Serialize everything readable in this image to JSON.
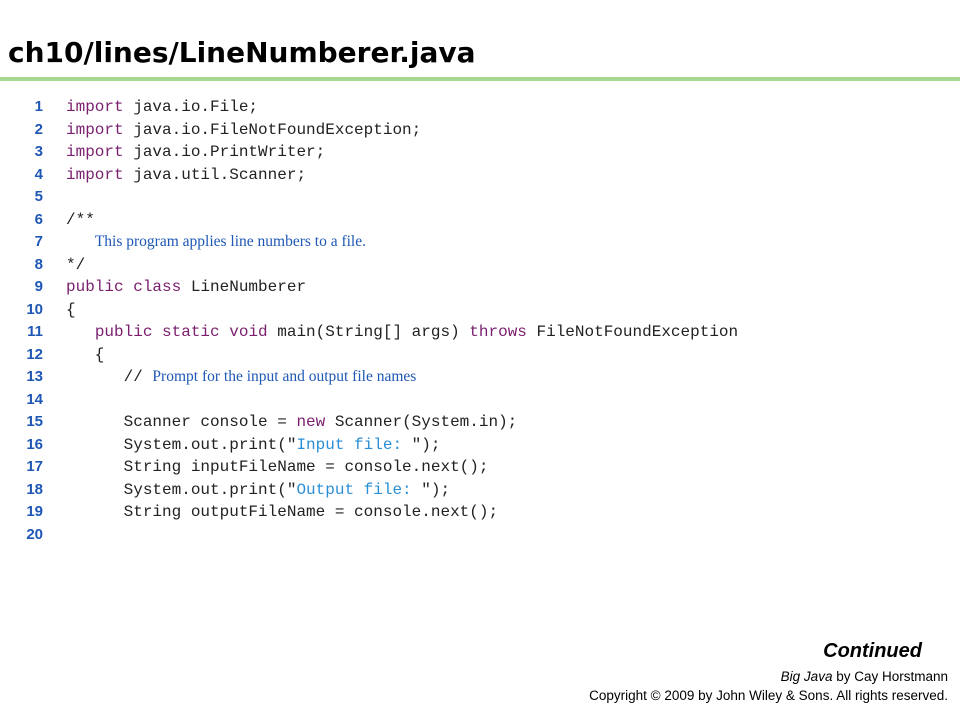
{
  "slide": {
    "title": "ch10/lines/LineNumberer.java",
    "continued": "Continued",
    "book_title": "Big Java",
    "book_author": " by Cay Horstmann",
    "copyright": "Copyright © 2009 by John Wiley & Sons.  All rights reserved."
  },
  "colors": {
    "keyword": "#7a1f6e",
    "string": "#2a8fd6",
    "comment": "#1f57b5",
    "line_number": "#1f57b5",
    "rule": "#a6d98f"
  },
  "code_lines": [
    {
      "num": "1",
      "parts": [
        {
          "t": "kw",
          "s": "import"
        },
        {
          "t": "pl",
          "s": " java.io.File;"
        }
      ]
    },
    {
      "num": "2",
      "parts": [
        {
          "t": "kw",
          "s": "import"
        },
        {
          "t": "pl",
          "s": " java.io.FileNotFoundException;"
        }
      ]
    },
    {
      "num": "3",
      "parts": [
        {
          "t": "kw",
          "s": "import"
        },
        {
          "t": "pl",
          "s": " java.io.PrintWriter;"
        }
      ]
    },
    {
      "num": "4",
      "parts": [
        {
          "t": "kw",
          "s": "import"
        },
        {
          "t": "pl",
          "s": " java.util.Scanner;"
        }
      ]
    },
    {
      "num": "5",
      "parts": []
    },
    {
      "num": "6",
      "parts": [
        {
          "t": "pl",
          "s": "/**"
        }
      ]
    },
    {
      "num": "7",
      "parts": [
        {
          "t": "pl",
          "s": "   "
        },
        {
          "t": "cmt",
          "s": "This program applies line numbers to a file."
        }
      ]
    },
    {
      "num": "8",
      "parts": [
        {
          "t": "pl",
          "s": "*/"
        }
      ]
    },
    {
      "num": "9",
      "parts": [
        {
          "t": "kw",
          "s": "public class"
        },
        {
          "t": "pl",
          "s": " LineNumberer"
        }
      ]
    },
    {
      "num": "10",
      "parts": [
        {
          "t": "pl",
          "s": "{"
        }
      ]
    },
    {
      "num": "11",
      "parts": [
        {
          "t": "pl",
          "s": "   "
        },
        {
          "t": "kw",
          "s": "public static void"
        },
        {
          "t": "pl",
          "s": " main(String[] args) "
        },
        {
          "t": "kw",
          "s": "throws"
        },
        {
          "t": "pl",
          "s": " FileNotFoundException"
        }
      ]
    },
    {
      "num": "12",
      "parts": [
        {
          "t": "pl",
          "s": "   {"
        }
      ]
    },
    {
      "num": "13",
      "parts": [
        {
          "t": "pl",
          "s": "      // "
        },
        {
          "t": "cmt",
          "s": "Prompt for the input and output file names"
        }
      ]
    },
    {
      "num": "14",
      "parts": []
    },
    {
      "num": "15",
      "parts": [
        {
          "t": "pl",
          "s": "      Scanner console = "
        },
        {
          "t": "kw",
          "s": "new"
        },
        {
          "t": "pl",
          "s": " Scanner(System.in);"
        }
      ]
    },
    {
      "num": "16",
      "parts": [
        {
          "t": "pl",
          "s": "      System.out.print(\""
        },
        {
          "t": "str",
          "s": "Input file: "
        },
        {
          "t": "pl",
          "s": "\");"
        }
      ]
    },
    {
      "num": "17",
      "parts": [
        {
          "t": "pl",
          "s": "      String inputFileName = console.next();"
        }
      ]
    },
    {
      "num": "18",
      "parts": [
        {
          "t": "pl",
          "s": "      System.out.print(\""
        },
        {
          "t": "str",
          "s": "Output file: "
        },
        {
          "t": "pl",
          "s": "\");"
        }
      ]
    },
    {
      "num": "19",
      "parts": [
        {
          "t": "pl",
          "s": "      String outputFileName = console.next();"
        }
      ]
    },
    {
      "num": "20",
      "parts": []
    }
  ]
}
